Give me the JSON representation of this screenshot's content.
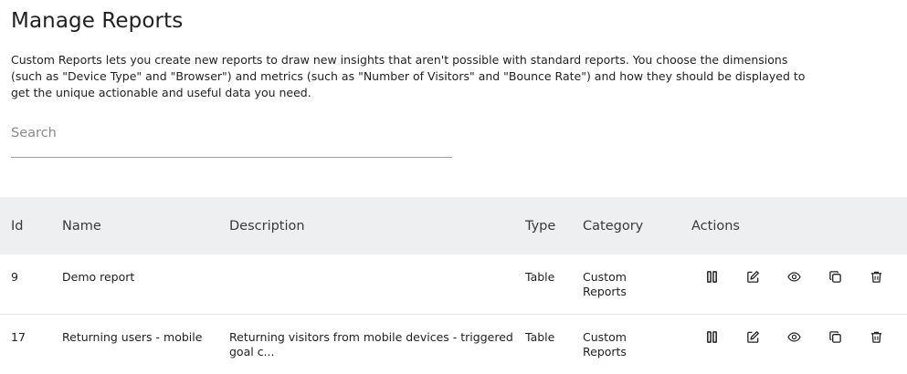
{
  "page": {
    "title": "Manage Reports",
    "description": "Custom Reports lets you create new reports to draw new insights that aren't possible with standard reports. You choose the dimensions (such as \"Device Type\" and \"Browser\") and metrics (such as \"Number of Visitors\" and \"Bounce Rate\") and how they should be displayed to get the unique actionable and useful data you need."
  },
  "search": {
    "placeholder": "Search",
    "value": ""
  },
  "table": {
    "columns": {
      "id": "Id",
      "name": "Name",
      "description": "Description",
      "type": "Type",
      "category": "Category",
      "actions": "Actions"
    },
    "rows": [
      {
        "id": "9",
        "name": "Demo report",
        "description": "",
        "type": "Table",
        "category_line1": "Custom",
        "category_line2": "Reports"
      },
      {
        "id": "17",
        "name": "Returning users - mobile",
        "description_line1": "Returning visitors from mobile devices - triggered",
        "description_line2": "goal c...",
        "type": "Table",
        "category_line1": "Custom",
        "category_line2": "Reports"
      }
    ],
    "action_icons": [
      "pause-icon",
      "edit-icon",
      "view-icon",
      "duplicate-icon",
      "delete-icon"
    ]
  }
}
